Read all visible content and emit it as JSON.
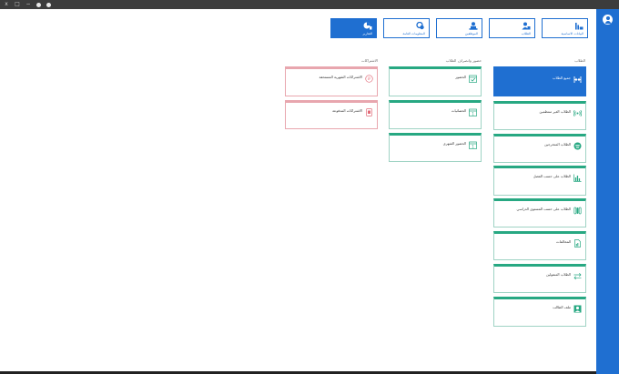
{
  "titlebar": {
    "buttons": [
      "x",
      "□",
      "−"
    ]
  },
  "topnav": [
    {
      "label": "التقارير",
      "icon": "report-chart-icon",
      "active": true
    },
    {
      "label": "المعلومات العامة",
      "icon": "info-gears-icon",
      "active": false
    },
    {
      "label": "الموظفين",
      "icon": "employees-icon",
      "active": false
    },
    {
      "label": "الطلاب",
      "icon": "students-icon",
      "active": false
    },
    {
      "label": "البيانات الاساسية",
      "icon": "basic-data-icon",
      "active": false
    }
  ],
  "sections": {
    "students": {
      "title": "الطلاب",
      "items": [
        {
          "label": "جميع الطلاب",
          "icon": "arrows-in-icon",
          "active": true
        },
        {
          "label": "الطلاب الغير منتظمين",
          "icon": "signal-icon"
        },
        {
          "label": "الطلاب المتخرجين",
          "icon": "stack-circle-icon"
        },
        {
          "label": "الطلاب على حسب الفصل",
          "icon": "bar-chart-icon"
        },
        {
          "label": "الطلاب على حسب المستوى الدراسي",
          "icon": "columns-icon"
        },
        {
          "label": "المخالفات",
          "icon": "document-icon"
        },
        {
          "label": "الطلاب المنقولين",
          "icon": "transfer-arrows-icon"
        },
        {
          "label": "ملف الطالب",
          "icon": "student-profile-icon"
        }
      ]
    },
    "attendance": {
      "title": "حضور وانصراف الطلاب",
      "items": [
        {
          "label": "الحضور",
          "icon": "attendance-icon"
        },
        {
          "label": "الحصائيات",
          "icon": "calendar-stats-icon"
        },
        {
          "label": "الحضور الشهري",
          "icon": "calendar-month-icon"
        }
      ]
    },
    "subscriptions": {
      "title": "الاشتراكات",
      "items": [
        {
          "label": "الاشتراكات الشهرية المستحقة",
          "icon": "coin-icon"
        },
        {
          "label": "الاشتراكات المدفوعة",
          "icon": "receipt-icon"
        }
      ]
    }
  },
  "colors": {
    "primary": "#1f6fd1",
    "green": "#27a882",
    "red": "#e16b78"
  }
}
